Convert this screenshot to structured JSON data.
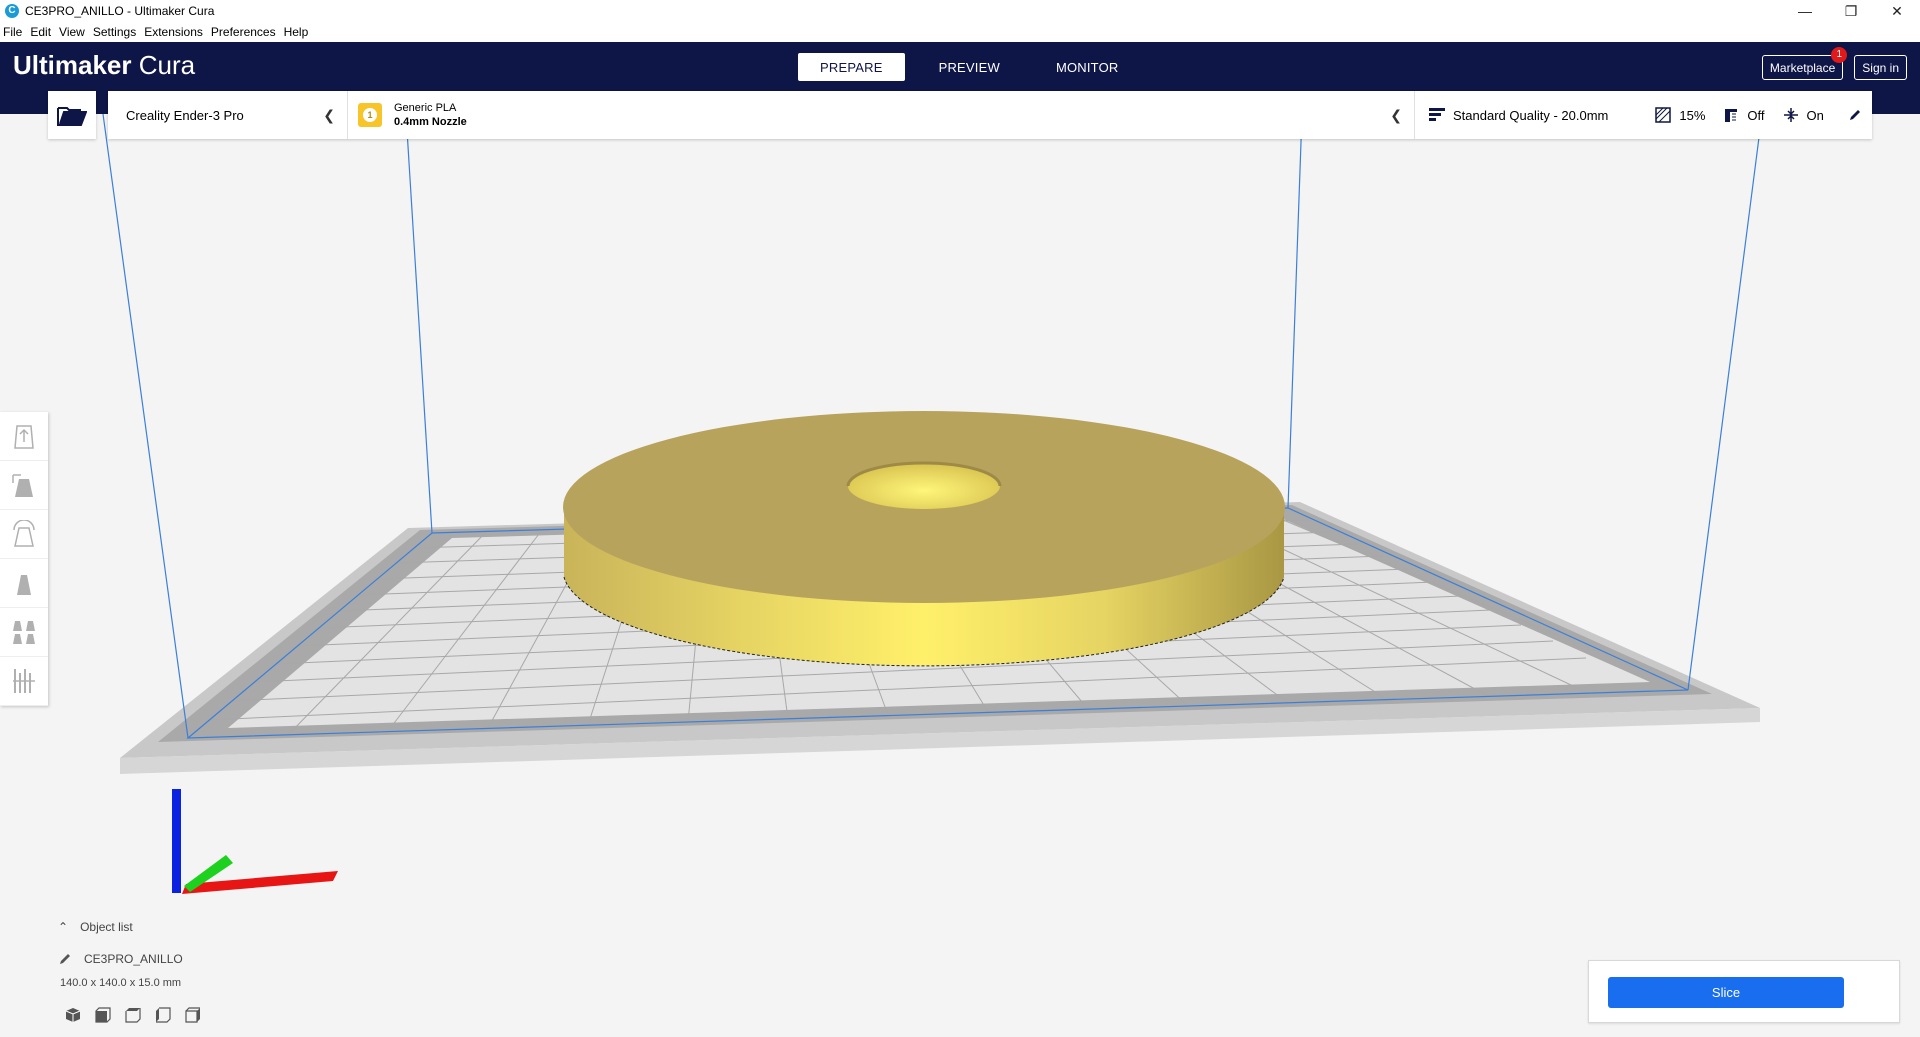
{
  "window": {
    "title": "CE3PRO_ANILLO - Ultimaker Cura",
    "minimize": "—",
    "restore": "❐",
    "close": "✕"
  },
  "menu": [
    "File",
    "Edit",
    "View",
    "Settings",
    "Extensions",
    "Preferences",
    "Help"
  ],
  "brand": {
    "bold": "Ultimaker",
    "light": "Cura"
  },
  "stages": [
    {
      "label": "PREPARE",
      "active": true
    },
    {
      "label": "PREVIEW",
      "active": false
    },
    {
      "label": "MONITOR",
      "active": false
    }
  ],
  "header": {
    "marketplace_label": "Marketplace",
    "marketplace_badge": "1",
    "signin_label": "Sign in"
  },
  "machine": {
    "printer_name": "Creality Ender-3 Pro",
    "extruder_number": "1",
    "material": "Generic PLA",
    "nozzle": "0.4mm Nozzle"
  },
  "print_settings": {
    "quality": "Standard Quality - 20.0mm",
    "infill": "15%",
    "support": "Off",
    "adhesion": "On"
  },
  "tools": [
    "move-tool",
    "scale-tool",
    "rotate-tool",
    "mirror-tool",
    "per-model-settings-tool",
    "support-blocker-tool"
  ],
  "object_list": {
    "toggle_label": "Object list",
    "object_name": "CE3PRO_ANILLO",
    "dimensions": "140.0 x 140.0 x 15.0 mm"
  },
  "camera_views": [
    "3d-view",
    "front-view",
    "top-view",
    "left-view",
    "right-view"
  ],
  "slice": {
    "button_label": "Slice"
  },
  "colors": {
    "header_bg": "#0e1547",
    "accent_blue": "#196ef0",
    "model_yellow": "#f3e16a",
    "material_badge": "#f7c52a"
  }
}
